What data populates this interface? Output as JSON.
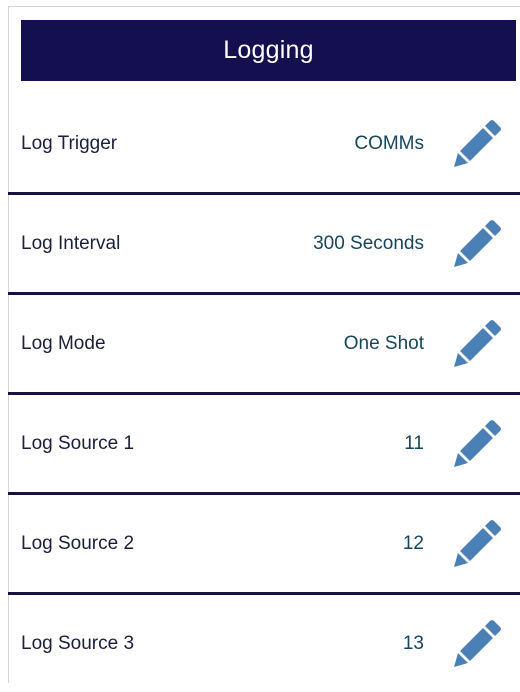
{
  "header": {
    "title": "Logging"
  },
  "colors": {
    "header_bg": "#140f4e",
    "divider": "#15133f",
    "value_text": "#16465a",
    "icon": "#4a80b5"
  },
  "rows": [
    {
      "label": "Log Trigger",
      "value": "COMMs",
      "icon": "pencil-icon"
    },
    {
      "label": "Log Interval",
      "value": "300 Seconds",
      "icon": "pencil-icon"
    },
    {
      "label": "Log Mode",
      "value": "One Shot",
      "icon": "pencil-icon"
    },
    {
      "label": "Log Source 1",
      "value": "11",
      "icon": "pencil-icon"
    },
    {
      "label": "Log Source 2",
      "value": "12",
      "icon": "pencil-icon"
    },
    {
      "label": "Log Source 3",
      "value": "13",
      "icon": "pencil-icon"
    }
  ]
}
